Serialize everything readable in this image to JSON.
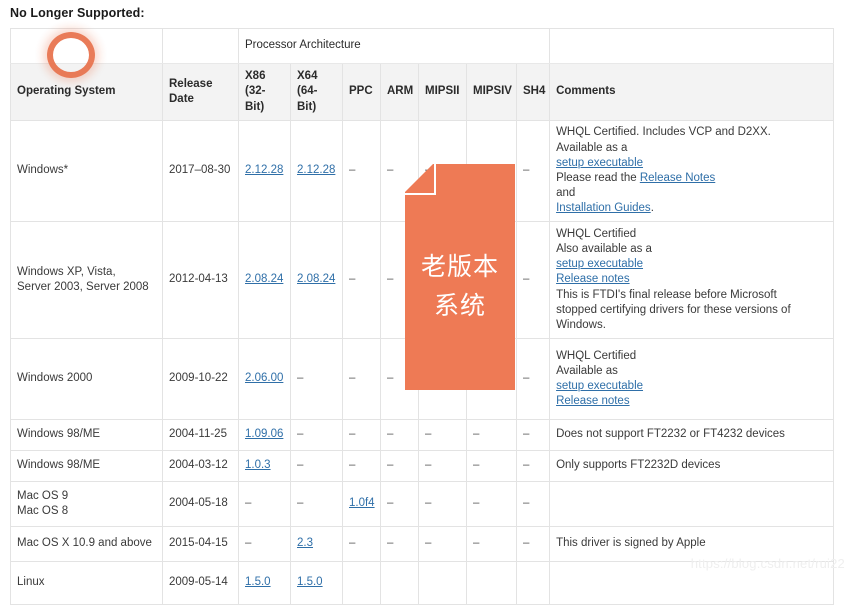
{
  "page": {
    "title": "No Longer Supported:",
    "watermark": "https://blog.csdn.net/rui22"
  },
  "table": {
    "group_header": {
      "blank_os": "",
      "blank_date": "",
      "processor_architecture": "Processor Architecture",
      "blank_comments": ""
    },
    "columns": [
      "Operating System",
      "Release Date",
      "X86 (32-Bit)",
      "X64 (64-Bit)",
      "PPC",
      "ARM",
      "MIPSII",
      "MIPSIV",
      "SH4",
      "Comments"
    ],
    "column_labels": {
      "os": "Operating System",
      "date_line1": "Release",
      "date_line2": "Date",
      "x86_line1": "X86",
      "x86_line2": "(32-",
      "x86_line3": "Bit)",
      "x64_line1": "X64",
      "x64_line2": "(64-",
      "x64_line3": "Bit)",
      "ppc": "PPC",
      "arm": "ARM",
      "mipsii": "MIPSII",
      "mipsiv": "MIPSIV",
      "sh4": "SH4",
      "comments": "Comments"
    },
    "rows": [
      {
        "os": "Windows*",
        "date": "2017–08-30",
        "x86": "2.12.28",
        "x64": "2.12.28",
        "ppc": "–",
        "arm": "–",
        "mipsii": "–",
        "mipsiv": "–",
        "sh4": "–",
        "comments": {
          "parts": [
            {
              "type": "text",
              "value": "WHQL Certified. Includes VCP and D2XX."
            },
            {
              "type": "break"
            },
            {
              "type": "text",
              "value": "Available as a"
            },
            {
              "type": "break"
            },
            {
              "type": "link",
              "value": "setup executable"
            },
            {
              "type": "break"
            },
            {
              "type": "text",
              "value": "Please read the "
            },
            {
              "type": "link",
              "value": "Release Notes"
            },
            {
              "type": "break"
            },
            {
              "type": "text",
              "value": "and"
            },
            {
              "type": "break"
            },
            {
              "type": "link",
              "value": "Installation Guides"
            },
            {
              "type": "text",
              "value": "."
            }
          ]
        }
      },
      {
        "os": "Windows XP, Vista, Server 2003, Server 2008",
        "os_line1": "Windows XP, Vista,",
        "os_line2": "Server 2003, Server 2008",
        "date": "2012-04-13",
        "x86": "2.08.24",
        "x64": "2.08.24",
        "ppc": "–",
        "arm": "–",
        "mipsii": "–",
        "mipsiv": "–",
        "sh4": "–",
        "comments": {
          "parts": [
            {
              "type": "text",
              "value": "WHQL Certified"
            },
            {
              "type": "break"
            },
            {
              "type": "text",
              "value": "Also available as a"
            },
            {
              "type": "break"
            },
            {
              "type": "link",
              "value": "setup executable"
            },
            {
              "type": "break"
            },
            {
              "type": "link",
              "value": "Release notes"
            },
            {
              "type": "break"
            },
            {
              "type": "text",
              "value": "This is FTDI's final release before Microsoft"
            },
            {
              "type": "break"
            },
            {
              "type": "text",
              "value": "stopped certifying drivers for these versions of"
            },
            {
              "type": "break"
            },
            {
              "type": "text",
              "value": "Windows."
            }
          ]
        }
      },
      {
        "os": "Windows 2000",
        "date": "2009-10-22",
        "x86": "2.06.00",
        "x64": "–",
        "ppc": "–",
        "arm": "–",
        "mipsii": "–",
        "mipsiv": "–",
        "sh4": "–",
        "comments": {
          "parts": [
            {
              "type": "text",
              "value": "WHQL Certified"
            },
            {
              "type": "break"
            },
            {
              "type": "text",
              "value": "Available as"
            },
            {
              "type": "break"
            },
            {
              "type": "link",
              "value": "setup executable"
            },
            {
              "type": "break"
            },
            {
              "type": "link",
              "value": "Release notes"
            }
          ]
        }
      },
      {
        "os": "Windows 98/ME",
        "date": "2004-11-25",
        "x86": "1.09.06",
        "x64": "–",
        "ppc": "–",
        "arm": "–",
        "mipsii": "–",
        "mipsiv": "–",
        "sh4": "–",
        "comments": {
          "parts": [
            {
              "type": "text",
              "value": "Does not support FT2232 or FT4232 devices"
            }
          ]
        }
      },
      {
        "os": "Windows 98/ME",
        "date": "2004-03-12",
        "x86": "1.0.3",
        "x64": "–",
        "ppc": "–",
        "arm": "–",
        "mipsii": "–",
        "mipsiv": "–",
        "sh4": "–",
        "comments": {
          "parts": [
            {
              "type": "text",
              "value": "Only supports FT2232D devices"
            }
          ]
        }
      },
      {
        "os": "Mac OS 9 Mac OS 8",
        "os_line1": "Mac OS 9",
        "os_line2": "Mac OS 8",
        "date": "2004-05-18",
        "x86": "–",
        "x64": "–",
        "ppc": "1.0f4",
        "arm": "–",
        "mipsii": "–",
        "mipsiv": "–",
        "sh4": "–",
        "comments": {
          "parts": []
        }
      },
      {
        "os": "Mac OS X 10.9 and above",
        "date": "2015-04-15",
        "x86": "–",
        "x64": "2.3",
        "ppc": "–",
        "arm": "–",
        "mipsii": "–",
        "mipsiv": "–",
        "sh4": "–",
        "comments": {
          "parts": [
            {
              "type": "text",
              "value": "This driver is signed by Apple"
            }
          ]
        }
      },
      {
        "os": "Linux",
        "date": "2009-05-14",
        "x86": "1.5.0",
        "x64": "1.5.0",
        "ppc": "",
        "arm": "",
        "mipsii": "",
        "mipsiv": "",
        "sh4": "",
        "comments": {
          "parts": []
        }
      }
    ]
  },
  "annotations": {
    "ring": {
      "name": "circle-highlight",
      "color": "#e8704a"
    },
    "note": {
      "name": "note-callout",
      "color": "#ee7a55",
      "line1": "老版本",
      "line2": "系统"
    }
  }
}
